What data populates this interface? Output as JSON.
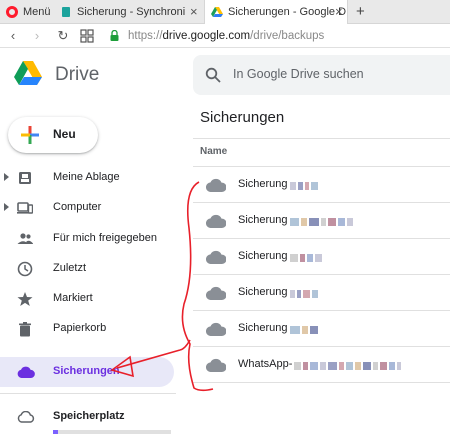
{
  "browser": {
    "tabs": [
      {
        "label": "Menü",
        "icon": "opera-icon"
      },
      {
        "label": "Sicherung - Synchroni",
        "icon": "page-icon"
      },
      {
        "label": "Sicherungen - Google D",
        "icon": "drive-icon",
        "active": true
      }
    ],
    "new_tab": "+",
    "close": "×",
    "url_prefix": "https://",
    "url_host": "drive.google.com",
    "url_path": "/drive/backups"
  },
  "app": {
    "name": "Drive",
    "search_placeholder": "In Google Drive suchen",
    "new_button": "Neu"
  },
  "sidebar": {
    "items": [
      {
        "label": "Meine Ablage",
        "icon": "my-drive-icon"
      },
      {
        "label": "Computer",
        "icon": "computers-icon"
      },
      {
        "label": "Für mich freigegeben",
        "icon": "shared-icon"
      },
      {
        "label": "Zuletzt",
        "icon": "recent-clock-icon"
      },
      {
        "label": "Markiert",
        "icon": "star-icon"
      },
      {
        "label": "Papierkorb",
        "icon": "trash-icon"
      },
      {
        "label": "Sicherungen",
        "icon": "backups-cloud-icon"
      },
      {
        "label": "Speicherplatz",
        "icon": "storage-cloud-icon"
      }
    ],
    "storage_used_fraction": 0.04
  },
  "main": {
    "title": "Sicherungen",
    "column_name": "Name",
    "files": [
      {
        "name": "Sicherung"
      },
      {
        "name": "Sicherung"
      },
      {
        "name": "Sicherung"
      },
      {
        "name": "Sicherung"
      },
      {
        "name": "Sicherung"
      },
      {
        "name": "WhatsApp-"
      }
    ]
  },
  "colors": {
    "accent": "#6b2fe0",
    "annotation": "#e8202a",
    "active_bg": "#e8e8f8"
  }
}
